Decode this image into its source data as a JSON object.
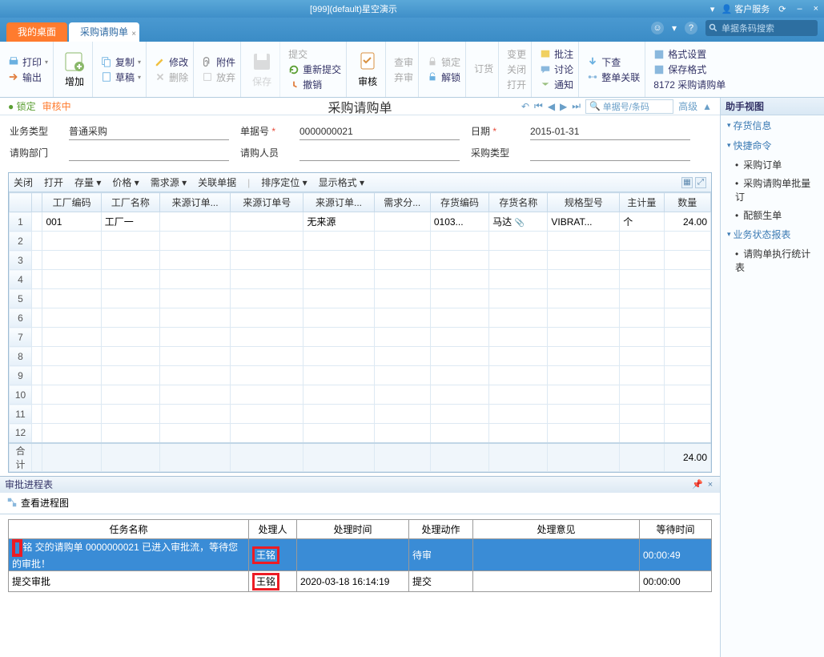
{
  "titlebar": {
    "app_title": "[999](default)星空演示",
    "svc": "客户服务",
    "min": "‒",
    "close": "×",
    "u": "⟳"
  },
  "tabs": {
    "desktop": "我的桌面",
    "doc": "采购请购单"
  },
  "search": {
    "placeholder": "单据条码搜索"
  },
  "ribbon": {
    "print": "打印",
    "output": "输出",
    "add": "增加",
    "copy": "复制",
    "draft": "草稿",
    "modify": "修改",
    "delete": "删除",
    "attach": "附件",
    "abandon": "放弃",
    "save": "保存",
    "submit": "提交",
    "resubmit": "重新提交",
    "revoke": "撤销",
    "audit": "审核",
    "lock": "锁定",
    "discard": "弃审",
    "unlock": "解锁",
    "order": "订货",
    "change": "变更",
    "close": "关闭",
    "open": "打开",
    "batch": "批注",
    "discuss": "讨论",
    "notify": "通知",
    "download": "下查",
    "rel": "整单关联",
    "format": "格式设置",
    "saveformat": "保存格式",
    "formatcode": "8172 采购请购单"
  },
  "status": {
    "lock": "锁定",
    "audit": "审核中",
    "title": "采购请购单",
    "search_ph": "单据号/条码",
    "adv": "高级"
  },
  "form": {
    "biz_type_l": "业务类型",
    "biz_type_v": "普通采购",
    "bill_no_l": "单据号",
    "bill_no_v": "0000000021",
    "date_l": "日期",
    "date_v": "2015-01-31",
    "dept_l": "请购部门",
    "dept_v": "",
    "person_l": "请购人员",
    "person_v": "",
    "ptype_l": "采购类型",
    "ptype_v": ""
  },
  "grid_tb": {
    "close": "关闭",
    "open": "打开",
    "stock": "存量",
    "price": "价格",
    "demand": "需求源",
    "rel": "关联单据",
    "sort": "排序定位",
    "disp": "显示格式"
  },
  "grid": {
    "cols": [
      "",
      "工厂编码",
      "工厂名称",
      "来源订单...",
      "来源订单号",
      "来源订单...",
      "需求分...",
      "存货编码",
      "存货名称",
      "规格型号",
      "主计量",
      "数量"
    ],
    "rows": [
      {
        "n": 1,
        "factory_code": "001",
        "factory_name": "工厂一",
        "src1": "",
        "src2": "",
        "src3": "无来源",
        "demand": "",
        "inv_code": "0103...",
        "inv_name": "马达",
        "spec": "VIBRAT...",
        "uom": "个",
        "qty": "24.00"
      }
    ],
    "empty_rows": [
      2,
      3,
      4,
      5,
      6,
      7,
      8,
      9,
      10,
      11,
      12
    ],
    "footer_label": "合计",
    "footer_qty": "24.00"
  },
  "right_panel": {
    "title": "助手视图",
    "sec1": "存货信息",
    "sec2": "快捷命令",
    "items2": [
      "采购订单",
      "采购请购单批量订",
      "配额生单"
    ],
    "sec3": "业务状态报表",
    "items3": [
      "请购单执行统计表"
    ]
  },
  "approval": {
    "title": "审批进程表",
    "view_btn": "查看进程图",
    "cols": [
      "任务名称",
      "处理人",
      "处理时间",
      "处理动作",
      "处理意见",
      "等待时间"
    ],
    "row1": {
      "task": "铭   交的请购单 0000000021 已进入审批流，等待您的审批！",
      "handler": "王铭",
      "time": "",
      "action": "待审",
      "opinion": "",
      "wait": "00:00:49"
    },
    "row2": {
      "task": "提交审批",
      "handler": "王铭",
      "time": "2020-03-18 16:14:19",
      "action": "提交",
      "opinion": "",
      "wait": "00:00:00"
    }
  }
}
